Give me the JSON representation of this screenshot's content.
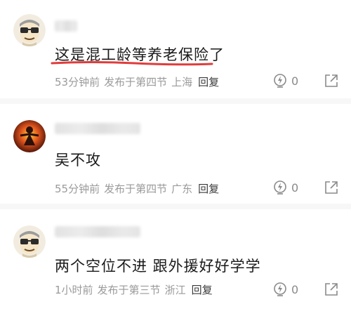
{
  "comments": [
    {
      "avatar_icon": "glasses-face-avatar-icon",
      "content": "这是混工龄等养老保险了",
      "time": "53分钟前",
      "published": "发布于第四节",
      "location": "上海",
      "reply_label": "回复",
      "likes": "0",
      "like_icon": "lightning-bulb-icon",
      "share_icon": "share-arrow-icon",
      "highlight_color": "#e03c3c"
    },
    {
      "avatar_icon": "flame-figure-avatar-icon",
      "content": "吴不攻",
      "time": "55分钟前",
      "published": "发布于第四节",
      "location": "广东",
      "reply_label": "回复",
      "likes": "0",
      "like_icon": "lightning-bulb-icon",
      "share_icon": "share-arrow-icon"
    },
    {
      "avatar_icon": "glasses-face-avatar-icon",
      "content": "两个空位不进 跟外援好好学学",
      "time": "1小时前",
      "published": "发布于第三节",
      "location": "浙江",
      "reply_label": "回复",
      "likes": "0",
      "like_icon": "lightning-bulb-icon",
      "share_icon": "share-arrow-icon"
    }
  ]
}
